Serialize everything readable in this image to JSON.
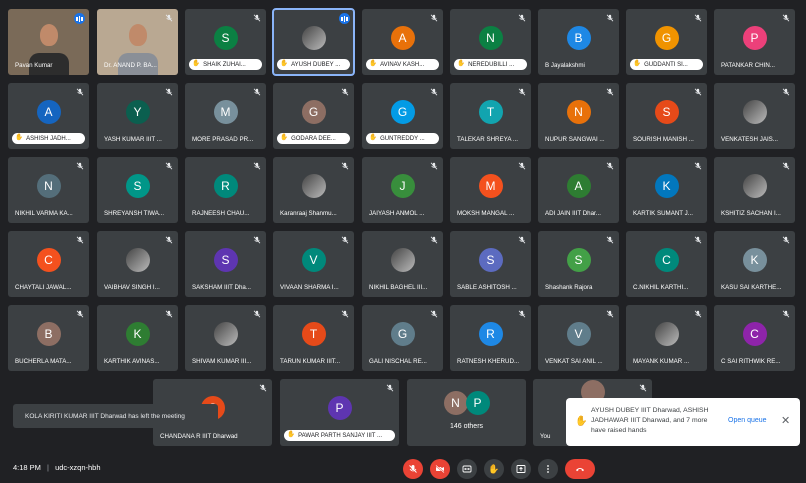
{
  "tiles": [
    {
      "name": "Pavan Kumar",
      "type": "video",
      "speaking_indicator": true
    },
    {
      "name": "Dr. ANAND P. BA...",
      "type": "video"
    },
    {
      "name": "SHAIK ZUHAI...",
      "letter": "S",
      "color": "#0b8043",
      "hand": true
    },
    {
      "name": "AYUSH DUBEY ...",
      "photo": true,
      "hand": true,
      "speaking": true,
      "speaking_indicator": true
    },
    {
      "name": "AVINAV KASH...",
      "letter": "A",
      "color": "#e8710a",
      "hand": true
    },
    {
      "name": "NEREDUBILLI ...",
      "letter": "N",
      "color": "#0b8043",
      "hand": true
    },
    {
      "name": "B Jayalakshmi",
      "letter": "B",
      "color": "#1e88e5"
    },
    {
      "name": "GUDDANTI SI...",
      "letter": "G",
      "color": "#f09300",
      "hand": true
    },
    {
      "name": "PATANKAR CHIN...",
      "letter": "P",
      "color": "#ec407a"
    },
    {
      "name": "ASHISH JADH...",
      "letter": "A",
      "color": "#1565c0",
      "hand": true
    },
    {
      "name": "YASH KUMAR IIIT ...",
      "letter": "Y",
      "color": "#0b5f4f"
    },
    {
      "name": "MORE PRASAD PR...",
      "letter": "M",
      "color": "#78909c"
    },
    {
      "name": "GODARA DEE...",
      "letter": "G",
      "color": "#8d6e63",
      "hand": true
    },
    {
      "name": "GUNTREDDY ...",
      "letter": "G",
      "color": "#039be5",
      "hand": true
    },
    {
      "name": "TALEKAR SHREYA ...",
      "letter": "T",
      "color": "#12a4af"
    },
    {
      "name": "NUPUR SANGWAI ...",
      "letter": "N",
      "color": "#e8710a"
    },
    {
      "name": "SOURISH MANISH ...",
      "letter": "S",
      "color": "#e64a19"
    },
    {
      "name": "VENKATESH JAIS...",
      "photo": true
    },
    {
      "name": "NIKHIL VARMA KA...",
      "letter": "N",
      "color": "#546e7a"
    },
    {
      "name": "SHREYANSH TIWA...",
      "letter": "S",
      "color": "#009688"
    },
    {
      "name": "RAJNEESH CHAU...",
      "letter": "R",
      "color": "#00897b"
    },
    {
      "name": "Karanraaj Shanmu...",
      "photo": true
    },
    {
      "name": "JAIYASH ANMOL ...",
      "letter": "J",
      "color": "#388e3c"
    },
    {
      "name": "MOKSH MANGAL ...",
      "letter": "M",
      "color": "#f4511e"
    },
    {
      "name": "ADI JAIN IIIT Dhar...",
      "letter": "A",
      "color": "#2e7d32"
    },
    {
      "name": "KARTIK SUMANT J...",
      "letter": "K",
      "color": "#0277bd"
    },
    {
      "name": "KSHITIZ SACHAN I...",
      "photo": true
    },
    {
      "name": "CHAYTALI JAWAL...",
      "letter": "C",
      "color": "#f4511e"
    },
    {
      "name": "VAIBHAV SINGH I...",
      "photo": true
    },
    {
      "name": "SAKSHAM IIIT Dha...",
      "letter": "S",
      "color": "#5e35b1"
    },
    {
      "name": "VIVAAN SHARMA I...",
      "letter": "V",
      "color": "#00897b"
    },
    {
      "name": "NIKHIL BAGHEL III...",
      "photo": true
    },
    {
      "name": "SABLE ASHITOSH ...",
      "letter": "S",
      "color": "#5c6bc0"
    },
    {
      "name": "Shashank Rajora",
      "letter": "S",
      "color": "#43a047"
    },
    {
      "name": "C.NIKHIL KARTHI...",
      "letter": "C",
      "color": "#00897b"
    },
    {
      "name": "KASU SAI KARTHE...",
      "letter": "K",
      "color": "#78909c"
    },
    {
      "name": "BUCHERLA MATA...",
      "letter": "B",
      "color": "#8d6e63"
    },
    {
      "name": "KARTHIK AVINAS...",
      "letter": "K",
      "color": "#2e7d32"
    },
    {
      "name": "SHIVAM KUMAR III...",
      "photo": true
    },
    {
      "name": "TARUN KUMAR IIIT...",
      "letter": "T",
      "color": "#e64a19"
    },
    {
      "name": "GALI NISCHAL RE...",
      "letter": "G",
      "color": "#607d8b"
    },
    {
      "name": "RATNESH KHERUD...",
      "letter": "R",
      "color": "#1e88e5"
    },
    {
      "name": "VENKAT SAI ANIL ...",
      "letter": "V",
      "color": "#607d8b"
    },
    {
      "name": "MAYANK KUMAR ...",
      "photo": true
    },
    {
      "name": "C SAI RITHWIK RE...",
      "letter": "C",
      "color": "#8e24aa"
    }
  ],
  "bottom_tiles": [
    {
      "name": "CHANDANA R IIIT Dharwad",
      "letter": "C",
      "color": "#e64a19"
    },
    {
      "name": "PAWAR PARTH SANJAY IIIT ...",
      "letter": "P",
      "color": "#5e35b1",
      "hand": true
    },
    {
      "others_label": "146 others",
      "letters": [
        "N",
        "P"
      ],
      "colors": [
        "#8d6e63",
        "#00897b"
      ]
    },
    {
      "name": "You",
      "letter": "",
      "color": "#5f6368"
    }
  ],
  "toast": "KOLA KIRITI KUMAR IIIT Dharwad has left the meeting",
  "hands_notice": {
    "text": "AYUSH DUBEY IIIT Dharwad, ASHISH JADHAWAR IIIT Dharwad, and 7 more have raised hands",
    "action": "Open queue",
    "close": "✕",
    "icon": "raised-hand-icon"
  },
  "bottom_bar": {
    "time": "4:18 PM",
    "separator": "|",
    "meeting_code": "udc-xzqn-hbh",
    "controls": [
      "mic-off-icon",
      "camera-off-icon",
      "captions-icon",
      "raise-hand-icon",
      "present-icon",
      "more-icon",
      "end-call-icon"
    ]
  }
}
